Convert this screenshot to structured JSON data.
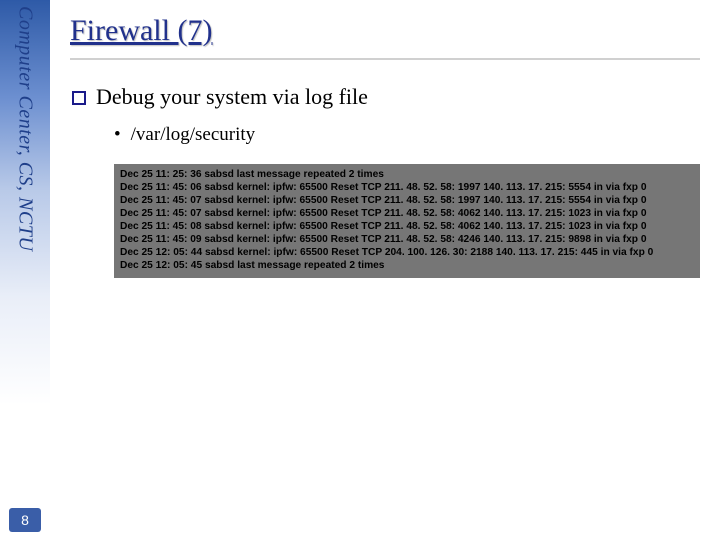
{
  "sidebar": {
    "org_text": "Computer Center, CS, NCTU",
    "page_number": "8"
  },
  "title": "Firewall (7)",
  "bullets": {
    "main": "Debug your system via log file",
    "sub": "/var/log/security"
  },
  "log_lines": [
    "Dec 25 11: 25: 36 sabsd last message repeated 2 times",
    "Dec 25 11: 45: 06 sabsd kernel: ipfw: 65500 Reset TCP 211. 48. 52. 58: 1997 140. 113. 17. 215: 5554 in via fxp 0",
    "Dec 25 11: 45: 07 sabsd kernel: ipfw: 65500 Reset TCP 211. 48. 52. 58: 1997 140. 113. 17. 215: 5554 in via fxp 0",
    "Dec 25 11: 45: 07 sabsd kernel: ipfw: 65500 Reset TCP 211. 48. 52. 58: 4062 140. 113. 17. 215: 1023 in via fxp 0",
    "Dec 25 11: 45: 08 sabsd kernel: ipfw: 65500 Reset TCP 211. 48. 52. 58: 4062 140. 113. 17. 215: 1023 in via fxp 0",
    "Dec 25 11: 45: 09 sabsd kernel: ipfw: 65500 Reset TCP 211. 48. 52. 58: 4246 140. 113. 17. 215: 9898 in via fxp 0",
    "Dec 25 12: 05: 44 sabsd kernel: ipfw: 65500 Reset TCP 204. 100. 126. 30: 2188 140. 113. 17. 215: 445 in via fxp 0",
    "Dec 25 12: 05: 45 sabsd last message repeated 2 times"
  ]
}
